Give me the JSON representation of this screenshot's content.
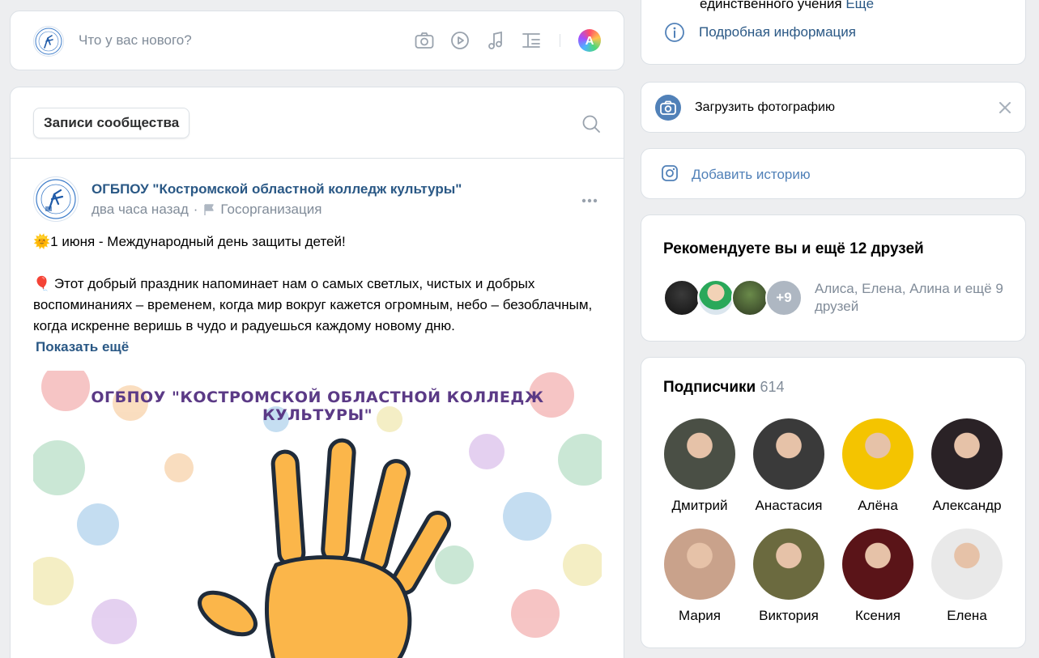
{
  "composer": {
    "placeholder": "Что у вас нового?"
  },
  "feed": {
    "tab_label": "Записи сообщества"
  },
  "post": {
    "author": "ОГБПОУ \"Костромской областной колледж культуры\"",
    "time": "два часа назад",
    "separator": "·",
    "tag": "Госорганизация",
    "line1_emoji": "🌞",
    "line1": "1 июня - Международный день защиты детей!",
    "line2_emoji": "🎈",
    "line2": "Этот добрый праздник напоминает нам о самых светлых, чистых и добрых воспоминаниях – временем, когда мир вокруг кажется огромным, небо – безоблачным, когда искренне веришь в чудо и радуешься каждому новому дню.",
    "show_more": "Показать ещё",
    "image_caption": "ОГБПОУ \"КОСТРОМСКОЙ ОБЛАСТНОЙ КОЛЛЕДЖ КУЛЬТУРЫ\""
  },
  "sidebar": {
    "info_fragment": "единственного учения",
    "info_fragment_link": "Ещё",
    "details_link": "Подробная информация",
    "upload_photo": "Загрузить фотографию",
    "add_story": "Добавить историю",
    "recommend_title": "Рекомендуете вы и ещё 12 друзей",
    "recommend_more": "+9",
    "recommend_text": "Алиса, Елена, Алина и ещё 9 друзей",
    "subs_title": "Подписчики",
    "subs_count": "614",
    "subscribers": [
      {
        "name": "Дмитрий",
        "color": "#4a4f45"
      },
      {
        "name": "Анастасия",
        "color": "#3a3a3a"
      },
      {
        "name": "Алёна",
        "color": "#f4c400"
      },
      {
        "name": "Александр",
        "color": "#2a2226"
      },
      {
        "name": "Мария",
        "color": "#c9a28b"
      },
      {
        "name": "Виктория",
        "color": "#6b6a3f"
      },
      {
        "name": "Ксения",
        "color": "#5a1418"
      },
      {
        "name": "Елена",
        "color": "#e9e9e9"
      }
    ]
  },
  "colors": {
    "link": "#2a5885",
    "muted": "#818c99",
    "icon": "#99a2ad",
    "background": "#edeef0",
    "hand": "#fbb64a"
  }
}
